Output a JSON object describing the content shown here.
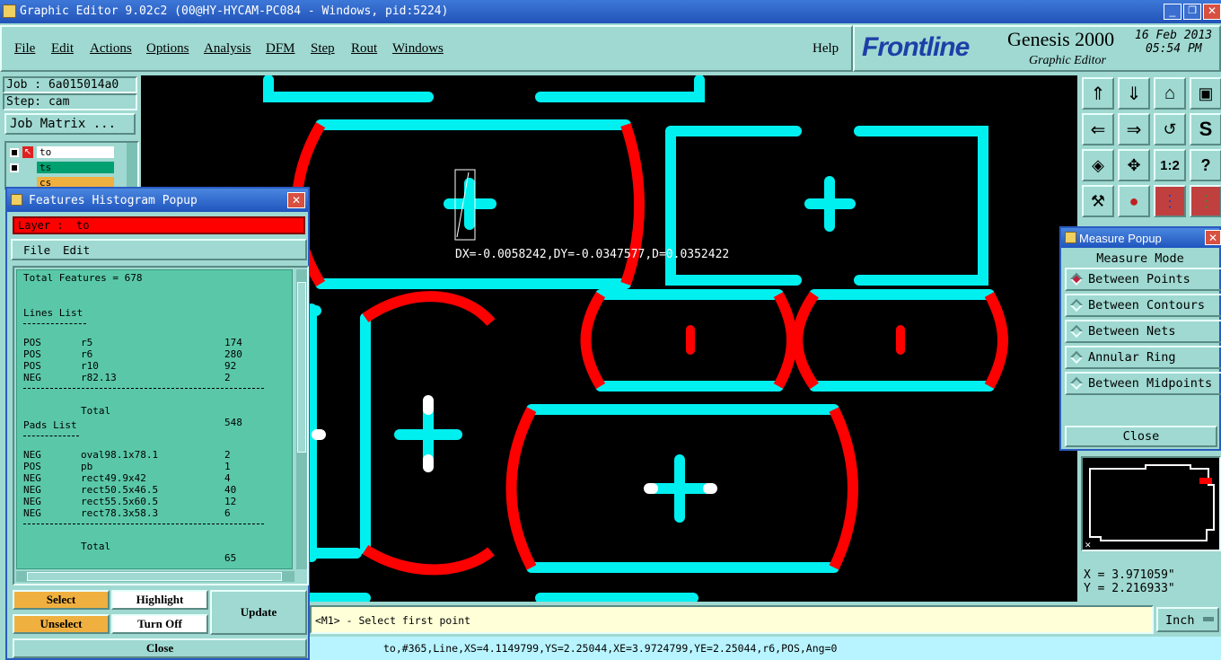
{
  "window": {
    "title": "Graphic Editor 9.02c2 (00@HY-HYCAM-PC084 - Windows, pid:5224)"
  },
  "menu": {
    "items": [
      "File",
      "Edit",
      "Actions",
      "Options",
      "Analysis",
      "DFM",
      "Step",
      "Rout",
      "Windows"
    ],
    "help": "Help"
  },
  "brand": {
    "logo": "Frontline",
    "product": "Genesis 2000",
    "subtitle": "Graphic Editor",
    "date": "16 Feb 2013",
    "time": "05:54 PM"
  },
  "left_panel": {
    "job": "Job : 6a015014a0",
    "step": "Step: cam",
    "job_matrix": "Job Matrix ...",
    "layers": [
      {
        "name": "to",
        "color": "#ffffff"
      },
      {
        "name": "ts",
        "color": "#00a070"
      },
      {
        "name": "cs",
        "color": "#f0b040"
      }
    ]
  },
  "histogram": {
    "title": "Features Histogram Popup",
    "layer_label": "Layer :  to",
    "menu": [
      "File",
      "Edit"
    ],
    "total_features": "Total Features = 678",
    "lines_heading": "Lines List",
    "lines": [
      {
        "pol": "POS",
        "sym": "r5",
        "count": "174"
      },
      {
        "pol": "POS",
        "sym": "r6",
        "count": "280"
      },
      {
        "pol": "POS",
        "sym": "r10",
        "count": "92"
      },
      {
        "pol": "NEG",
        "sym": "r82.13",
        "count": "2"
      }
    ],
    "lines_total_label": "Total",
    "lines_total": "548",
    "pads_heading": "Pads List",
    "pads": [
      {
        "pol": "NEG",
        "sym": "oval98.1x78.1",
        "count": "2"
      },
      {
        "pol": "POS",
        "sym": "pb",
        "count": "1"
      },
      {
        "pol": "NEG",
        "sym": "rect49.9x42",
        "count": "4"
      },
      {
        "pol": "NEG",
        "sym": "rect50.5x46.5",
        "count": "40"
      },
      {
        "pol": "NEG",
        "sym": "rect55.5x60.5",
        "count": "12"
      },
      {
        "pol": "NEG",
        "sym": "rect78.3x58.3",
        "count": "6"
      }
    ],
    "pads_total_label": "Total",
    "pads_total": "65",
    "buttons": {
      "select": "Select",
      "highlight": "Highlight",
      "update": "Update",
      "unselect": "Unselect",
      "turn_off": "Turn Off",
      "close": "Close"
    }
  },
  "measure": {
    "title": "Measure Popup",
    "mode_label": "Measure Mode",
    "modes": [
      "Between Points",
      "Between Contours",
      "Between Nets",
      "Annular Ring",
      "Between Midpoints"
    ],
    "selected_mode": "Between Points",
    "close": "Close"
  },
  "canvas": {
    "measure_readout": "DX=-0.0058242,DY=-0.0347577,D=0.0352422"
  },
  "coords": {
    "x": "X = 3.971059\"",
    "y": "Y = 2.216933\""
  },
  "status": {
    "prompt": "<M1> - Select first point",
    "units": "Inch",
    "feature_info": "to,#365,Line,XS=4.1149799,YS=2.25044,XE=3.9724799,YE=2.25044,r6,POS,Ang=0"
  },
  "colors": {
    "cyan": "#00f0f0",
    "red": "#ff0000",
    "panel": "#9fd9d1",
    "list_bg": "#5ac8a8"
  }
}
